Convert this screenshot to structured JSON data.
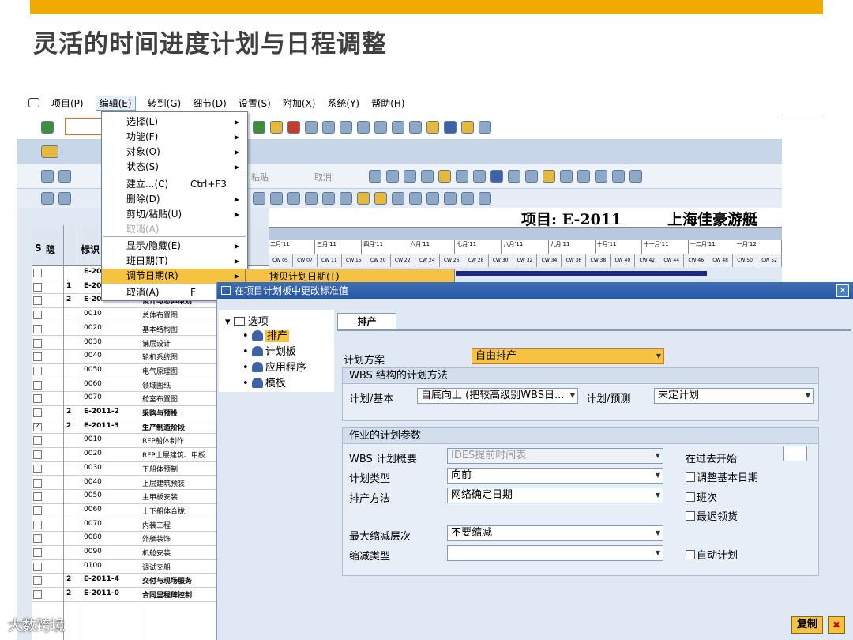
{
  "slide": {
    "title": "灵活的时间进度计划与日程调整",
    "accent": "#f2a900"
  },
  "menubar": {
    "items": [
      "项目(P)",
      "编辑(E)",
      "转到(G)",
      "细节(D)",
      "设置(S)",
      "附加(X)",
      "系统(Y)",
      "帮助(H)"
    ]
  },
  "appbar": {
    "paste": "粘贴",
    "undo": "取消"
  },
  "table": {
    "hdr_s": "S",
    "hdr_hide": "隐",
    "hdr_id": "标识",
    "rows": [
      {
        "lvl": "",
        "code": "E-20",
        "desc": "",
        "bold": true
      },
      {
        "lvl": "1",
        "code": "E-20",
        "desc": "",
        "bold": true
      },
      {
        "lvl": "2",
        "code": "E-2011-1",
        "desc": "设计与总体策划",
        "bold": true
      },
      {
        "lvl": "",
        "code": "0010",
        "desc": "总体布置图",
        "bold": false
      },
      {
        "lvl": "",
        "code": "0020",
        "desc": "基本结构图",
        "bold": false
      },
      {
        "lvl": "",
        "code": "0030",
        "desc": "铺层设计",
        "bold": false
      },
      {
        "lvl": "",
        "code": "0040",
        "desc": "轮机系统图",
        "bold": false
      },
      {
        "lvl": "",
        "code": "0050",
        "desc": "电气原理图",
        "bold": false
      },
      {
        "lvl": "",
        "code": "0060",
        "desc": "领域图纸",
        "bold": false
      },
      {
        "lvl": "",
        "code": "0070",
        "desc": "舱室布置图",
        "bold": false
      },
      {
        "lvl": "2",
        "code": "E-2011-2",
        "desc": "采购与预投",
        "bold": true
      },
      {
        "lvl": "2",
        "code": "E-2011-3",
        "desc": "生产制造阶段",
        "bold": true,
        "checked": true
      },
      {
        "lvl": "",
        "code": "0010",
        "desc": "RFP船体制作",
        "bold": false
      },
      {
        "lvl": "",
        "code": "0020",
        "desc": "RFP上层建筑、甲板",
        "bold": false
      },
      {
        "lvl": "",
        "code": "0030",
        "desc": "下船体预制",
        "bold": false
      },
      {
        "lvl": "",
        "code": "0040",
        "desc": "上层建筑预装",
        "bold": false
      },
      {
        "lvl": "",
        "code": "0050",
        "desc": "主甲板安装",
        "bold": false
      },
      {
        "lvl": "",
        "code": "0060",
        "desc": "上下船体合拢",
        "bold": false
      },
      {
        "lvl": "",
        "code": "0070",
        "desc": "内装工程",
        "bold": false
      },
      {
        "lvl": "",
        "code": "0080",
        "desc": "外舾装饰",
        "bold": false
      },
      {
        "lvl": "",
        "code": "0090",
        "desc": "机舱安装",
        "bold": false
      },
      {
        "lvl": "",
        "code": "0100",
        "desc": "调试交船",
        "bold": false
      },
      {
        "lvl": "2",
        "code": "E-2011-4",
        "desc": "交付与现场服务",
        "bold": true
      },
      {
        "lvl": "2",
        "code": "E-2011-0",
        "desc": "合同里程碑控制",
        "bold": true
      }
    ]
  },
  "gantt": {
    "project_id": "项目: E-2011",
    "project_name": "上海佳豪游艇",
    "months": [
      "二月'11",
      "三月'11",
      "四月'11",
      "六月'11",
      "七月'11",
      "八月'11",
      "九月'11",
      "十月'11",
      "十一月'11",
      "十二月'11",
      "一月'12"
    ],
    "weeks": [
      "CW 05",
      "CW 07",
      "CW 11",
      "CW 15",
      "CW 20",
      "CW 22",
      "CW 24",
      "CW 26",
      "CW 28",
      "CW 30",
      "CW 32",
      "CW 34",
      "CW 36",
      "CW 38",
      "CW 40",
      "CW 42",
      "CW 44",
      "CW 46",
      "CW 48",
      "CW 50",
      "CW 52"
    ]
  },
  "menu": {
    "items": [
      {
        "label": "选择(L)",
        "arrow": true
      },
      {
        "label": "功能(F)",
        "arrow": true
      },
      {
        "label": "对象(O)",
        "arrow": true
      },
      {
        "label": "状态(S)",
        "arrow": true
      },
      {
        "label": "建立...(C)",
        "shortcut": "Ctrl+F3"
      },
      {
        "label": "删除(D)",
        "arrow": true
      },
      {
        "label": "剪切/粘贴(U)",
        "arrow": true
      },
      {
        "label": "取消(A)",
        "disabled": true
      },
      {
        "label": "显示/隐藏(E)",
        "arrow": true
      },
      {
        "label": "班日期(T)",
        "arrow": true
      },
      {
        "label": "调节日期(R)",
        "arrow": true,
        "highlight": true
      },
      {
        "label": "取消(A)",
        "shortcut": "F"
      }
    ],
    "submenu": "拷贝计划日期(T)"
  },
  "dialog": {
    "title": "在项目计划板中更改标准值",
    "tree": {
      "root": "选项",
      "items": [
        "排产",
        "计划板",
        "应用程序",
        "模板"
      ]
    },
    "tab": "排产",
    "plan_scheme_label": "计划方案",
    "plan_scheme_value": "自由排产",
    "wbs_group_title": "WBS 结构的计划方法",
    "plan_basic_label": "计划/基本",
    "plan_basic_value": "自底向上 (把较高级别WBS日...",
    "plan_forecast_label": "计划/预测",
    "plan_forecast_value": "未定计划",
    "act_group_title": "作业的计划参数",
    "wbs_overview_label": "WBS 计划概要",
    "wbs_overview_value": "IDES提前时间表",
    "plan_type_label": "计划类型",
    "plan_type_value": "向前",
    "sched_method_label": "排产方法",
    "sched_method_value": "网络确定日期",
    "past_start_label": "在过去开始",
    "adjust_basic": "调整基本日期",
    "shift": "班次",
    "latest_receipt": "最迟领货",
    "max_reduce_label": "最大缩减层次",
    "max_reduce_value": "不要缩减",
    "reduce_type_label": "缩减类型",
    "reduce_type_value": "",
    "auto_plan": "自动计划",
    "copy_button": "复制",
    "cancel_button": "✖"
  },
  "watermark": "大数跨境"
}
